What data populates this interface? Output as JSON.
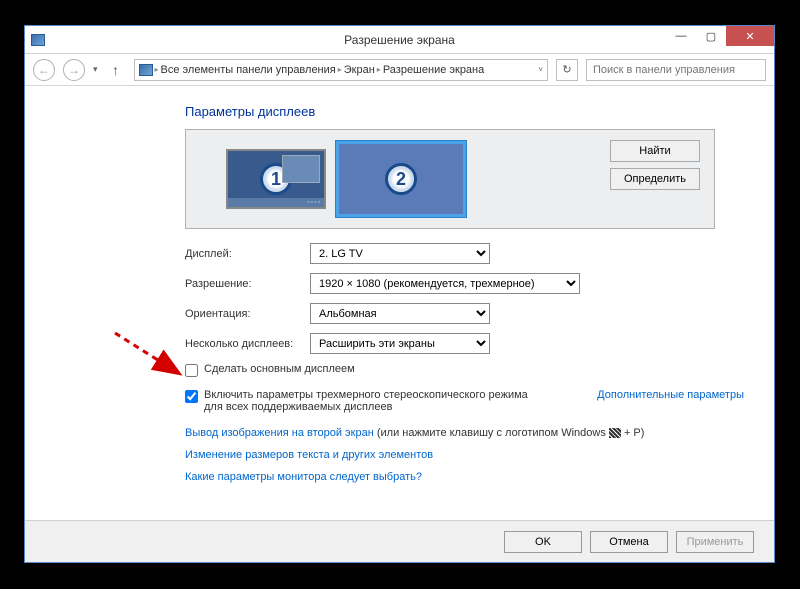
{
  "titlebar": {
    "title": "Разрешение экрана"
  },
  "breadcrumb": {
    "item1": "Все элементы панели управления",
    "item2": "Экран",
    "item3": "Разрешение экрана"
  },
  "search": {
    "placeholder": "Поиск в панели управления"
  },
  "heading": "Параметры дисплеев",
  "preview": {
    "monitor1_number": "1",
    "monitor2_number": "2",
    "find_btn": "Найти",
    "identify_btn": "Определить"
  },
  "form": {
    "display_label": "Дисплей:",
    "display_value": "2. LG TV",
    "resolution_label": "Разрешение:",
    "resolution_value": "1920 × 1080 (рекомендуется, трехмерное)",
    "orientation_label": "Ориентация:",
    "orientation_value": "Альбомная",
    "multi_label": "Несколько дисплеев:",
    "multi_value": "Расширить эти экраны"
  },
  "checkbox": {
    "make_primary_label": "Сделать основным дисплеем",
    "stereo_label": "Включить параметры трехмерного стереоскопического режима для всех поддерживаемых дисплеев",
    "additional_params": "Дополнительные параметры"
  },
  "links": {
    "projection_link": "Вывод изображения на второй экран",
    "projection_rest": " (или нажмите клавишу с логотипом Windows ",
    "projection_key": " + P)",
    "text_size": "Изменение размеров текста и других элементов",
    "which_monitor": "Какие параметры монитора следует выбрать?"
  },
  "buttons": {
    "ok": "OK",
    "cancel": "Отмена",
    "apply": "Применить"
  }
}
